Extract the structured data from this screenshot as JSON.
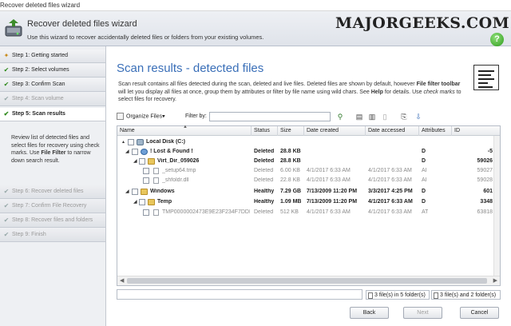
{
  "window": {
    "title": "Recover deleted files wizard"
  },
  "header": {
    "title": "Recover deleted files wizard",
    "subtitle": "Use this wizard to recover accidentally deleted files or folders from your existing volumes.",
    "watermark": "MAJORGEEKS.COM",
    "help_glyph": "?"
  },
  "sidebar": {
    "steps": [
      {
        "label": "Step 1: Getting started",
        "icon": "wand-icon",
        "state": "done"
      },
      {
        "label": "Step 2: Select volumes",
        "icon": "check-icon",
        "state": "done"
      },
      {
        "label": "Step 3: Confirm Scan",
        "icon": "check-icon",
        "state": "done"
      },
      {
        "label": "Step 4: Scan volume",
        "icon": "check-icon",
        "state": "disabled"
      },
      {
        "label": "Step 5: Scan results",
        "icon": "check-icon",
        "state": "active"
      },
      {
        "label": "Step 6: Recover deleted files",
        "icon": "check-icon",
        "state": "disabled"
      },
      {
        "label": "Step 7: Confirm File Recovery",
        "icon": "check-icon",
        "state": "disabled"
      },
      {
        "label": "Step 8: Recover files and folders",
        "icon": "check-icon",
        "state": "disabled"
      },
      {
        "label": "Step 9: Finish",
        "icon": "check-icon",
        "state": "disabled"
      }
    ],
    "description_pre": "Review list of detected files and select files for recovery using check marks. Use ",
    "description_bold": "File Filter",
    "description_post": " to narrow down search result."
  },
  "main": {
    "title": "Scan results - detected files",
    "desc_pre": "Scan result contains all files detected during the scan, deleted and live files. Deleted files are shown by default, however ",
    "desc_bold1": "File filter toolbar",
    "desc_mid": " will let you display all files at once, group them by attributes or filter by file name using wild chars. See ",
    "desc_bold2": "Help",
    "desc_mid2": " for details. Use ",
    "desc_italic": "check marks",
    "desc_post": " to select files for recovery."
  },
  "toolbar": {
    "organize_label": "Organize Files",
    "organize_arrow": "▾",
    "filter_label": "Filter by:",
    "filter_value": ""
  },
  "table": {
    "sort_indicator": "▲",
    "columns": [
      "Name",
      "Status",
      "Size",
      "Date created",
      "Date accessed",
      "Attributes",
      "ID"
    ],
    "rows": [
      {
        "name": "Local Disk (C:)",
        "status": "",
        "size": "",
        "created": "",
        "accessed": "",
        "attr": "",
        "id": "",
        "indent": 0,
        "icon": "disk",
        "style": "bold",
        "exp": "▴"
      },
      {
        "name": "! Lost & Found !",
        "status": "Deleted",
        "size": "28.8 KB",
        "created": "",
        "accessed": "",
        "attr": "D",
        "id": "-5",
        "indent": 1,
        "icon": "lost",
        "style": "bold",
        "exp": "◢"
      },
      {
        "name": "Virt_Dir_059026",
        "status": "Deleted",
        "size": "28.8 KB",
        "created": "",
        "accessed": "",
        "attr": "D",
        "id": "59026",
        "indent": 2,
        "icon": "folder",
        "style": "bold",
        "exp": "◢"
      },
      {
        "name": "_setup64.tmp",
        "status": "Deleted",
        "size": "6.00 KB",
        "created": "4/1/2017 6:33 AM",
        "accessed": "4/1/2017 6:33 AM",
        "attr": "AI",
        "id": "59027",
        "indent": 3,
        "icon": "file",
        "style": "grey",
        "exp": ""
      },
      {
        "name": "_shfoldr.dll",
        "status": "Deleted",
        "size": "22.8 KB",
        "created": "4/1/2017 6:33 AM",
        "accessed": "4/1/2017 6:33 AM",
        "attr": "AI",
        "id": "59028",
        "indent": 3,
        "icon": "file",
        "style": "grey",
        "exp": ""
      },
      {
        "name": "Windows",
        "status": "Healthy",
        "size": "7.29 GB",
        "created": "7/13/2009 11:20 PM",
        "accessed": "3/3/2017 4:25 PM",
        "attr": "D",
        "id": "601",
        "indent": 1,
        "icon": "folder",
        "style": "bold",
        "exp": "◢"
      },
      {
        "name": "Temp",
        "status": "Healthy",
        "size": "1.09 MB",
        "created": "7/13/2009 11:20 PM",
        "accessed": "4/1/2017 6:33 AM",
        "attr": "D",
        "id": "3348",
        "indent": 2,
        "icon": "folder",
        "style": "bold",
        "exp": "◢"
      },
      {
        "name": "TMP0000002473E9E23F234F7DDF",
        "status": "Deleted",
        "size": "512 KB",
        "created": "4/1/2017 6:33 AM",
        "accessed": "4/1/2017 6:33 AM",
        "attr": "AT",
        "id": "63818",
        "indent": 3,
        "icon": "file",
        "style": "grey",
        "exp": ""
      }
    ]
  },
  "status": {
    "selected": "3 file(s) in 5 folder(s)",
    "total": "3 file(s) and 2 folder(s)"
  },
  "buttons": {
    "back": "Back",
    "next": "Next",
    "cancel": "Cancel"
  }
}
